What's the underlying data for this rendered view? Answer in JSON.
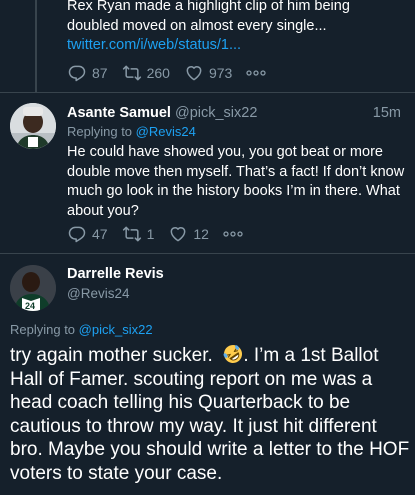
{
  "tweet_prev": {
    "text_lines": [
      "Rex Ryan made a highlight clip of him being",
      "doubled moved on almost every single..."
    ],
    "link": "twitter.com/i/web/status/1...",
    "stats": {
      "replies": "87",
      "retweets": "260",
      "likes": "973"
    }
  },
  "tweet_reply": {
    "name": "Asante Samuel",
    "handle": "@pick_six22",
    "time": "15m",
    "replying_prefix": "Replying to ",
    "replying_handle": "@Revis24",
    "text": "He could have showed you, you got beat or more double move then myself. That’s a fact! If don’t know much go look in the history books I’m in there. What about you?",
    "stats": {
      "replies": "47",
      "retweets": "1",
      "likes": "12"
    }
  },
  "tweet_main": {
    "name": "Darrelle Revis",
    "handle": "@Revis24",
    "replying_prefix": "Replying to ",
    "replying_handle": "@pick_six22",
    "text_before_emoji": "try again mother sucker.  ",
    "emoji": "rolling-on-floor-laughing",
    "text_after_emoji": ".  I’m a 1st Ballot Hall of Famer.  scouting report on me was a head coach telling his Quarterback to be cautious to throw my way.  It just hit different bro.  Maybe you should write a letter to the HOF voters to state your case."
  },
  "colors": {
    "background": "#15202b",
    "text": "#ffffff",
    "muted": "#8899a6",
    "link": "#1da1f2",
    "divider": "#38444d"
  }
}
